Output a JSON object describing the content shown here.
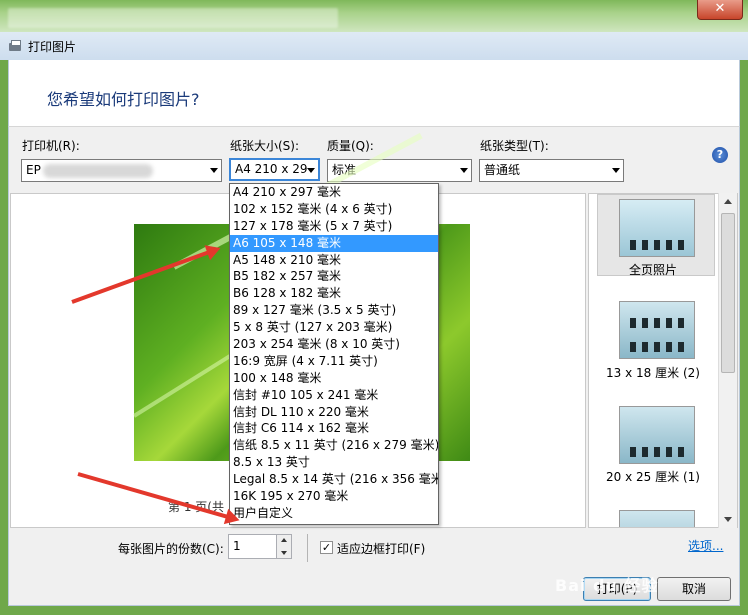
{
  "window": {
    "title": "打印图片",
    "close_label": "✕"
  },
  "header": {
    "question": "您希望如何打印图片?"
  },
  "printer": {
    "label": "打印机(R):",
    "value": "EP"
  },
  "paper_size": {
    "label": "纸张大小(S):",
    "value": "A4 210 x 29"
  },
  "quality": {
    "label": "质量(Q):",
    "value": "标准"
  },
  "paper_type": {
    "label": "纸张类型(T):",
    "value": "普通纸"
  },
  "help_label": "?",
  "paper_options": [
    "A4 210 x 297 毫米",
    "102 x 152 毫米 (4 x 6 英寸)",
    "127 x 178 毫米 (5 x 7 英寸)",
    "A6 105 x 148 毫米",
    "A5 148 x 210 毫米",
    "B5 182 x 257 毫米",
    "B6 128 x 182 毫米",
    "89 x 127 毫米 (3.5 x 5 英寸)",
    "5 x 8 英寸 (127 x 203 毫米)",
    "203 x 254 毫米 (8 x 10 英寸)",
    "16:9 宽屏 (4 x 7.11 英寸)",
    "100 x 148 毫米",
    "信封 #10 105 x 241 毫米",
    "信封 DL  110 x 220 毫米",
    "信封 C6  114 x 162 毫米",
    "信纸 8.5 x 11 英寸 (216 x 279 毫米)",
    "8.5 x 13 英寸",
    "Legal 8.5 x 14 英寸 (216 x 356 毫米)",
    "16K 195 x 270 毫米",
    "用户自定义"
  ],
  "selected_option_index": 3,
  "preview": {
    "page_info": "第 1 页(共 1"
  },
  "layouts": [
    {
      "label": "全页照片"
    },
    {
      "label": "13 x 18 厘米 (2)"
    },
    {
      "label": "20 x 25 厘米 (1)"
    }
  ],
  "copies": {
    "label": "每张图片的份数(C):",
    "value": "1"
  },
  "fit_frame": {
    "label": "适应边框打印(F)",
    "checked": "✓"
  },
  "options_link": "选项...",
  "buttons": {
    "print": "打印(P)",
    "cancel": "取消"
  },
  "watermark": "Bai du 经验"
}
